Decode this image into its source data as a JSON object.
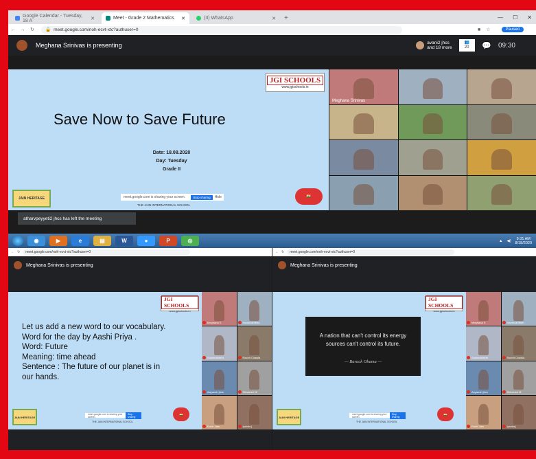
{
  "browser": {
    "tabs": [
      {
        "label": "Google Calendar - Tuesday, 18 A",
        "color": "#4285f4"
      },
      {
        "label": "Meet - Grade 2 Mathematics",
        "color": "#00897b"
      },
      {
        "label": "(3) WhatsApp",
        "color": "#25d366"
      }
    ],
    "new_tab": "+",
    "url": "meet.google.com/noh-ecvt-xtc?authuser=0",
    "paused": "Paused"
  },
  "meet": {
    "presenter_text": "Meghana Srinivas is presenting",
    "participants_line1": "avani2 jhcs",
    "participants_line2": "and 18 more",
    "clock": "09:30"
  },
  "slide": {
    "logo_brand": "JGI SCHOOLS",
    "logo_site": "www.jgischools.in",
    "title": "Save Now to Save Future",
    "date": "Date: 18.08.2020",
    "day": "Day: Tuesday",
    "grade": "Grade II",
    "heritage": "JAIN HERITAGE",
    "share_text": "meet.google.com is sharing your screen.",
    "stop_sharing": "Stop sharing",
    "hide": "Hide",
    "school": "THE JAIN INTERNATIONAL SCHOOL"
  },
  "grid_tiles": [
    {
      "label": "Meghana Srinivas",
      "color": "#c07a7a"
    },
    {
      "label": "",
      "color": "#9fb0c0"
    },
    {
      "label": "",
      "color": "#b8a590"
    },
    {
      "label": "",
      "color": "#c8b48a"
    },
    {
      "label": "",
      "color": "#6f9a5a"
    },
    {
      "label": "",
      "color": "#8a8a7a"
    },
    {
      "label": "",
      "color": "#7a8aa0"
    },
    {
      "label": "",
      "color": "#a0a090"
    },
    {
      "label": "",
      "color": "#d0a040"
    },
    {
      "label": "",
      "color": "#8aa0b0"
    },
    {
      "label": "",
      "color": "#b09070"
    },
    {
      "label": "",
      "color": "#90a070"
    }
  ],
  "toast": "atharvpeyyeti2 jhcs has left the meeting",
  "taskbar": {
    "icons": [
      {
        "glyph": "◉",
        "color": "#3a8fd8"
      },
      {
        "glyph": "▶",
        "color": "#e07020"
      },
      {
        "glyph": "e",
        "color": "#2b7bd8"
      },
      {
        "glyph": "▤",
        "color": "#e0b040"
      },
      {
        "glyph": "W",
        "color": "#2b5797"
      },
      {
        "glyph": "●",
        "color": "#3399ff"
      },
      {
        "glyph": "P",
        "color": "#d24726"
      },
      {
        "glyph": "◎",
        "color": "#4caf50"
      }
    ],
    "time": "9:31 AM",
    "date": "8/18/2020"
  },
  "bottom_left": {
    "url": "meet.google.com/noh-ecvt-xtc?authuser=0",
    "presenter_text": "Meghana Srinivas is presenting",
    "vocab_lines": [
      "Let us add a new word to our vocabulary.",
      "Word for the day by Aashi Priya .",
      "Word: Future",
      "Meaning: time ahead",
      "Sentence : The future of our planet is in",
      "our hands."
    ]
  },
  "bottom_right": {
    "url": "meet.google.com/noh-ecvt-xtc?authuser=0",
    "presenter_text": "Meghana Srinivas is presenting",
    "quote_line1": "A nation that can't control its energy",
    "quote_line2": "sources can't control its future.",
    "quote_author": "— Barack Obama —"
  },
  "small_grid_tiles": [
    {
      "label": "Meghana S",
      "color": "#c07a7a"
    },
    {
      "label": "Harshvardhan",
      "color": "#9fb0c0"
    },
    {
      "label": "Sukhmanreet",
      "color": "#b0b8c8"
    },
    {
      "label": "Rachit Chawla",
      "color": "#8a7a6a"
    },
    {
      "label": "Aayansh jhcs",
      "color": "#6a8ab0"
    },
    {
      "label": "Shivansh M",
      "color": "#a0a0a0"
    },
    {
      "label": "Rohit Jain",
      "color": "#c8a080"
    },
    {
      "label": "Ipshita j",
      "color": "#907060"
    }
  ]
}
